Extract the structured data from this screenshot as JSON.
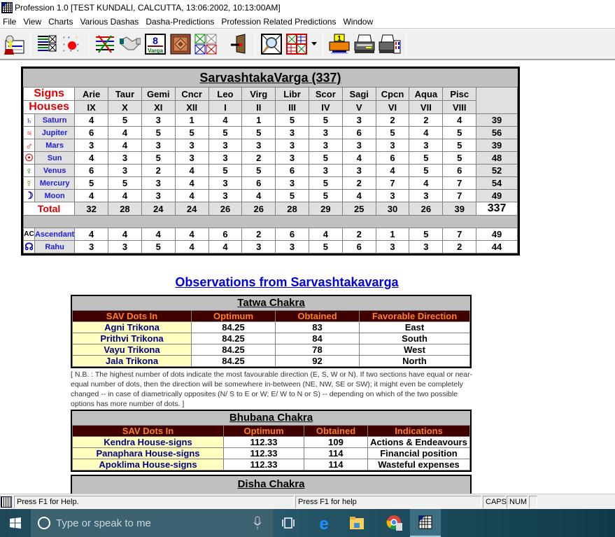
{
  "window": {
    "title": "Profession 1.0 [TEST KUNDALI, CALCUTTA, 13:06:2002, 10:13:00AM]"
  },
  "menu": [
    "File",
    "View",
    "Charts",
    "Various Dashas",
    "Dasha-Predictions",
    "Profession Related Predictions",
    "Window"
  ],
  "toolbar": {
    "icons": [
      "person-card-icon",
      "table-list-icon",
      "dots-chart-icon",
      "cross-lines-chart-icon",
      "handshake-icon",
      "varga-8-icon",
      "square-chart-icon",
      "four-charts-icon",
      "exit-door-icon",
      "magnifier-chart-icon",
      "multi-chart-icon",
      "dropdown-arrow-icon",
      "print-preview-icon",
      "printer-icon",
      "color-printer-icon"
    ],
    "varga_label": "8",
    "varga_sub": "Varga",
    "print_num": "1"
  },
  "sav": {
    "title": "SarvashtakaVarga (337)",
    "signs_label": "Signs",
    "houses_label": "Houses",
    "signs": [
      "Arie",
      "Taur",
      "Gemi",
      "Cncr",
      "Leo",
      "Virg",
      "Libr",
      "Scor",
      "Sagi",
      "Cpcn",
      "Aqua",
      "Pisc"
    ],
    "houses": [
      "IX",
      "X",
      "XI",
      "XII",
      "I",
      "II",
      "III",
      "IV",
      "V",
      "VI",
      "VII",
      "VIII"
    ],
    "planets": [
      {
        "name": "Saturn",
        "symbol": "♄",
        "color": "#0000c0",
        "values": [
          "4",
          "5",
          "3",
          "1",
          "4",
          "1",
          "5",
          "5",
          "3",
          "2",
          "2",
          "4"
        ],
        "total": "39"
      },
      {
        "name": "Jupiter",
        "symbol": "♃",
        "color": "#e00000",
        "values": [
          "6",
          "4",
          "5",
          "5",
          "5",
          "5",
          "3",
          "3",
          "6",
          "5",
          "4",
          "5"
        ],
        "total": "56"
      },
      {
        "name": "Mars",
        "symbol": "♂",
        "color": "#e00000",
        "values": [
          "3",
          "4",
          "3",
          "3",
          "3",
          "3",
          "3",
          "3",
          "3",
          "3",
          "3",
          "5"
        ],
        "total": "39"
      },
      {
        "name": "Sun",
        "symbol": "☉",
        "color": "#e00000",
        "values": [
          "4",
          "3",
          "5",
          "3",
          "3",
          "2",
          "3",
          "5",
          "4",
          "6",
          "5",
          "5"
        ],
        "total": "48"
      },
      {
        "name": "Venus",
        "symbol": "♀",
        "color": "#008000",
        "values": [
          "6",
          "3",
          "2",
          "4",
          "5",
          "5",
          "6",
          "3",
          "3",
          "4",
          "5",
          "6"
        ],
        "total": "52"
      },
      {
        "name": "Mercury",
        "symbol": "☿",
        "color": "#808000",
        "values": [
          "5",
          "5",
          "3",
          "4",
          "3",
          "6",
          "3",
          "5",
          "2",
          "7",
          "4",
          "7"
        ],
        "total": "54"
      },
      {
        "name": "Moon",
        "symbol": "☽",
        "color": "#0000c0",
        "values": [
          "4",
          "4",
          "3",
          "4",
          "3",
          "4",
          "5",
          "5",
          "4",
          "3",
          "3",
          "7"
        ],
        "total": "49"
      }
    ],
    "total_label": "Total",
    "totals": [
      "32",
      "28",
      "24",
      "24",
      "26",
      "26",
      "28",
      "29",
      "25",
      "30",
      "26",
      "39"
    ],
    "grand_total": "337",
    "extra": [
      {
        "name": "Ascendant",
        "symbol": "AC",
        "color": "#000000",
        "values": [
          "4",
          "4",
          "4",
          "4",
          "6",
          "2",
          "6",
          "4",
          "2",
          "1",
          "5",
          "7"
        ],
        "total": "49"
      },
      {
        "name": "Rahu",
        "symbol": "☊",
        "color": "#0000c0",
        "values": [
          "3",
          "3",
          "5",
          "4",
          "4",
          "3",
          "3",
          "5",
          "6",
          "3",
          "3",
          "2"
        ],
        "total": "44"
      }
    ]
  },
  "observations": {
    "title": "Observations from Sarvashtakavarga",
    "tatwa": {
      "title": "Tatwa Chakra",
      "headers": [
        "SAV Dots In",
        "Optimum",
        "Obtained",
        "Favorable Direction"
      ],
      "rows": [
        [
          "Agni Trikona",
          "84.25",
          "83",
          "East"
        ],
        [
          "Prithvi Trikona",
          "84.25",
          "84",
          "South"
        ],
        [
          "Vayu Trikona",
          "84.25",
          "78",
          "West"
        ],
        [
          "Jala Trikona",
          "84.25",
          "92",
          "North"
        ]
      ]
    },
    "note": "[ N.B. : The highest number of dots indicate the most favourable direction (E, S, W or N). If two sections have equal or near-equal number of dots, then the direction will be somewhere in-between (NE, NW, SE or SW); it might even be completely changed -- in case of diametrically opposites (N/ S to E or W; E/ W to N or S) -- depending on which of the two possible options has more number of dots. ]",
    "bhubana": {
      "title": "Bhubana Chakra",
      "headers": [
        "SAV Dots In",
        "Optimum",
        "Obtained",
        "Indications"
      ],
      "rows": [
        [
          "Kendra House-signs",
          "112.33",
          "109",
          "Actions & Endeavours"
        ],
        [
          "Panaphara House-signs",
          "112.33",
          "114",
          "Financial position"
        ],
        [
          "Apoklima House-signs",
          "112.33",
          "114",
          "Wasteful expenses"
        ]
      ]
    },
    "disha": {
      "title": "Disha Chakra"
    }
  },
  "status": {
    "left": "Press F1 for Help.",
    "middle": "Press F1 for help",
    "caps": "CAPS",
    "num": "NUM"
  },
  "taskbar": {
    "search_placeholder": "Type or speak to me"
  },
  "colors": {
    "header_bg": "#400000",
    "header_text": "#ff8020",
    "name_cell": "#ffffc0",
    "link_blue": "#0000e0",
    "label_red": "#e00000"
  }
}
